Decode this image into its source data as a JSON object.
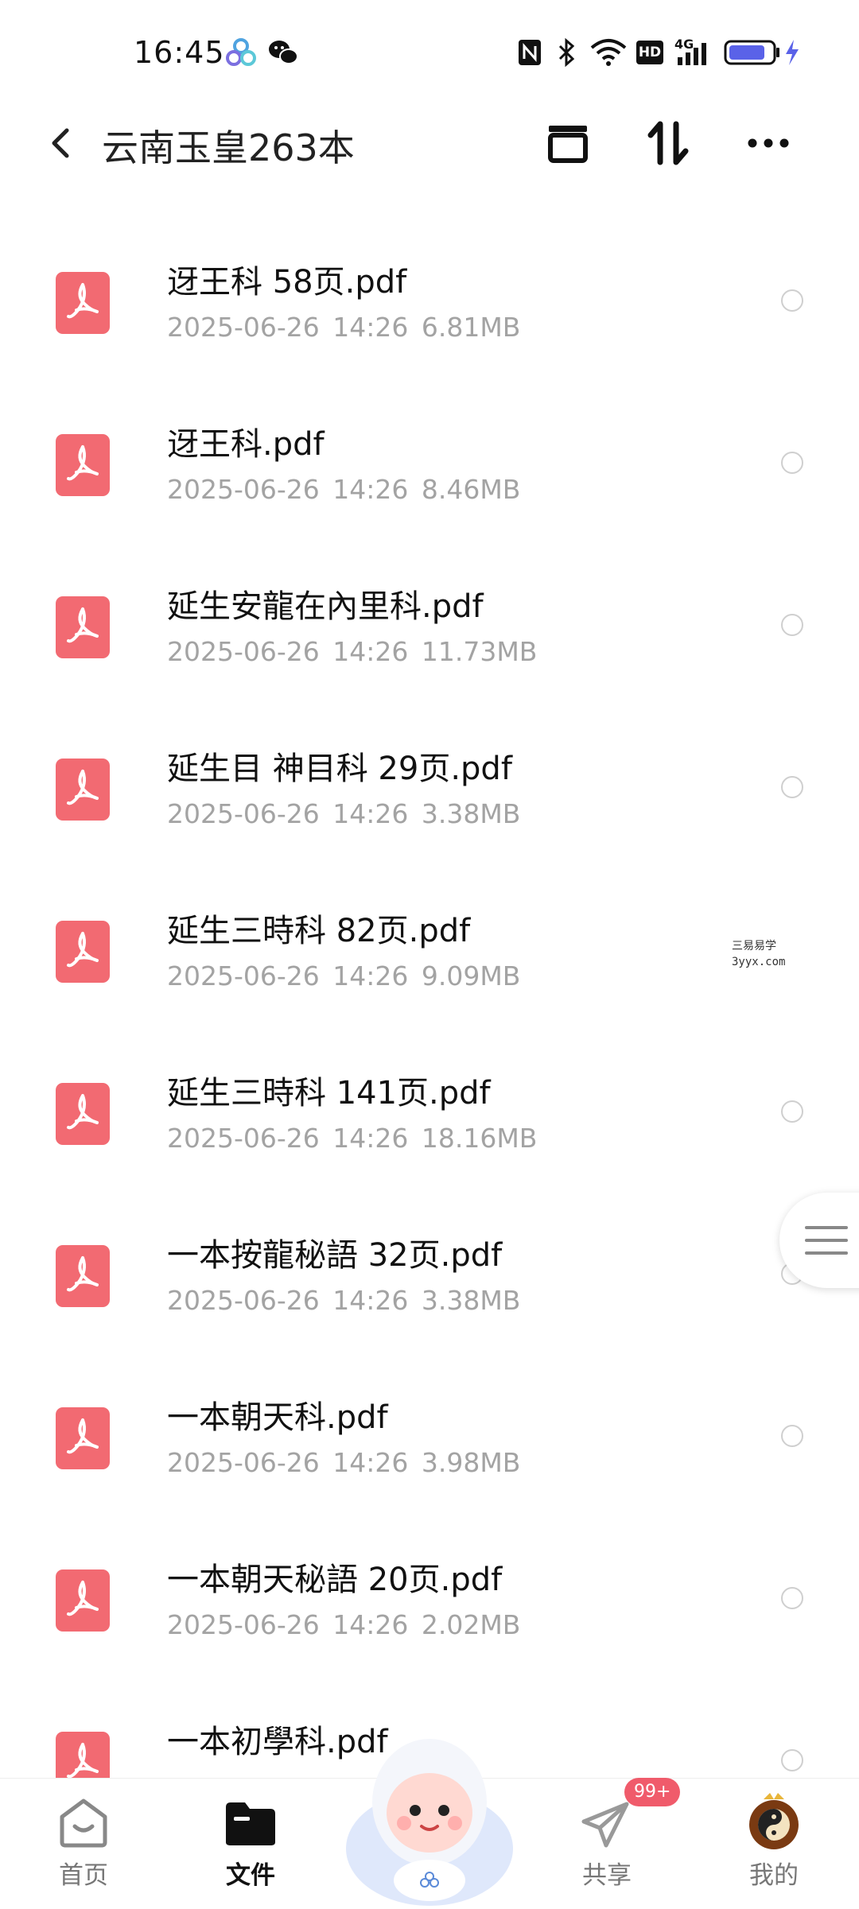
{
  "status_bar": {
    "time": "16:45",
    "hd_label": "HD",
    "network_label": "4G",
    "icons": [
      "app-logo-icon",
      "wechat-icon",
      "nfc-icon",
      "bluetooth-icon",
      "wifi-icon",
      "hd-icon",
      "signal-icon",
      "battery-icon",
      "charging-icon"
    ]
  },
  "header": {
    "title": "云南玉皇263本",
    "buttons": [
      "back-icon",
      "archive-icon",
      "sort-icon",
      "more-icon"
    ]
  },
  "files": [
    {
      "name": "迓王科 58页.pdf",
      "meta": "2025-06-26  14:26  6.81MB"
    },
    {
      "name": "迓王科.pdf",
      "meta": "2025-06-26  14:26  8.46MB"
    },
    {
      "name": "延生安龍在內里科.pdf",
      "meta": "2025-06-26  14:26  11.73MB"
    },
    {
      "name": "延生目 神目科 29页.pdf",
      "meta": "2025-06-26  14:26  3.38MB"
    },
    {
      "name": "延生三時科 82页.pdf",
      "meta": "2025-06-26  14:26  9.09MB"
    },
    {
      "name": "延生三時科 141页.pdf",
      "meta": "2025-06-26  14:26  18.16MB"
    },
    {
      "name": "一本按龍秘語 32页.pdf",
      "meta": "2025-06-26  14:26  3.38MB"
    },
    {
      "name": "一本朝天科.pdf",
      "meta": "2025-06-26  14:26  3.98MB"
    },
    {
      "name": "一本朝天秘語 20页.pdf",
      "meta": "2025-06-26  14:26  2.02MB"
    },
    {
      "name": "一本初學科.pdf",
      "meta": ""
    }
  ],
  "watermark": {
    "line1": "三易易学",
    "line2": "3yyx.com"
  },
  "bottom_nav": {
    "items": [
      {
        "label": "首页"
      },
      {
        "label": "文件"
      },
      {
        "label": "共享"
      },
      {
        "label": "我的"
      }
    ],
    "active_index": 1,
    "badge": "99+"
  },
  "colors": {
    "pdf_red": "#f26a72",
    "accent_dark": "#111111",
    "meta_gray": "#a3a3a3",
    "badge": "#f05b6b"
  }
}
